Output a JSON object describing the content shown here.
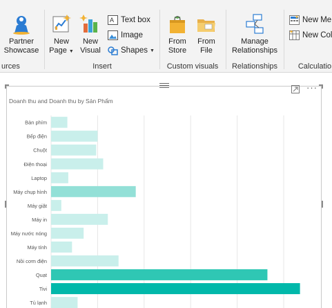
{
  "ribbon": {
    "groups": [
      {
        "label": "urces"
      },
      {
        "label": "Insert"
      },
      {
        "label": "Custom visuals"
      },
      {
        "label": "Relationships"
      },
      {
        "label": "Calculatio"
      }
    ],
    "partner_showcase": {
      "line1": "Partner",
      "line2": "Showcase"
    },
    "new_page": {
      "line1": "New",
      "line2": "Page"
    },
    "new_visual": {
      "line1": "New",
      "line2": "Visual"
    },
    "text_box": "Text box",
    "image": "Image",
    "shapes": "Shapes",
    "from_store": {
      "line1": "From",
      "line2": "Store"
    },
    "from_file": {
      "line1": "From",
      "line2": "File"
    },
    "manage_relationships": {
      "line1": "Manage",
      "line2": "Relationships"
    },
    "new_measure": "New Me",
    "new_column": "New Col"
  },
  "visual": {
    "title": "Doanh thu and Doanh thu by Sản Phẩm",
    "more": "···"
  },
  "chart_data": {
    "type": "bar",
    "orientation": "horizontal",
    "title": "Doanh thu and Doanh thu by Sản Phẩm",
    "categories": [
      "Bàn phím",
      "Bếp điện",
      "Chuột",
      "Điện thoại",
      "Laptop",
      "Máy chụp hình",
      "Máy giặt",
      "Máy in",
      "Máy nước nóng",
      "Máy tính",
      "Nồi cơm điện",
      "Quạt",
      "Tivi",
      "Tủ lạnh"
    ],
    "values": [
      0.35,
      1.0,
      0.97,
      1.12,
      0.37,
      1.82,
      0.22,
      1.22,
      0.7,
      0.45,
      1.45,
      4.65,
      5.35,
      0.57
    ],
    "xlim": [
      0,
      5.5
    ],
    "grid": true,
    "colors": {
      "light": "#c9efeb",
      "mid": "#93e0d7",
      "strong": "#2fc7b4",
      "max": "#01b8aa"
    }
  }
}
